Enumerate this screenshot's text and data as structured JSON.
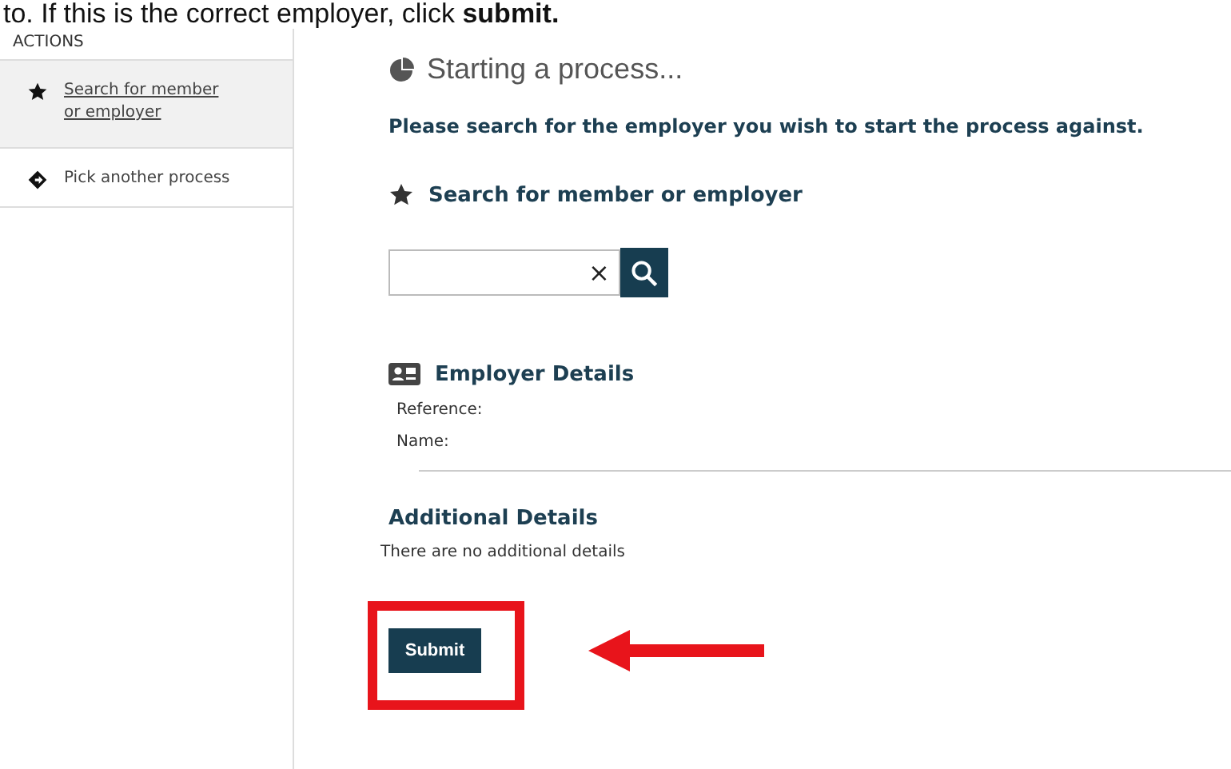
{
  "instruction": "to. If this is the correct employer, click **submit.**",
  "sidebar": {
    "title": "ACTIONS",
    "items": [
      {
        "label": "Search for member or employer",
        "selected": true
      },
      {
        "label": "Pick another process",
        "selected": false
      }
    ]
  },
  "main": {
    "title": "Starting a process...",
    "prompt": "Please search for the employer you wish to start the process against.",
    "search_section": {
      "heading": "Search for member or employer",
      "clear": "×"
    },
    "employer_details": {
      "heading": "Employer Details",
      "fields": [
        "Reference:",
        "Name:"
      ]
    },
    "additional_details": {
      "heading": "Additional Details",
      "text": "There are no additional details"
    },
    "submit": "Submit"
  }
}
